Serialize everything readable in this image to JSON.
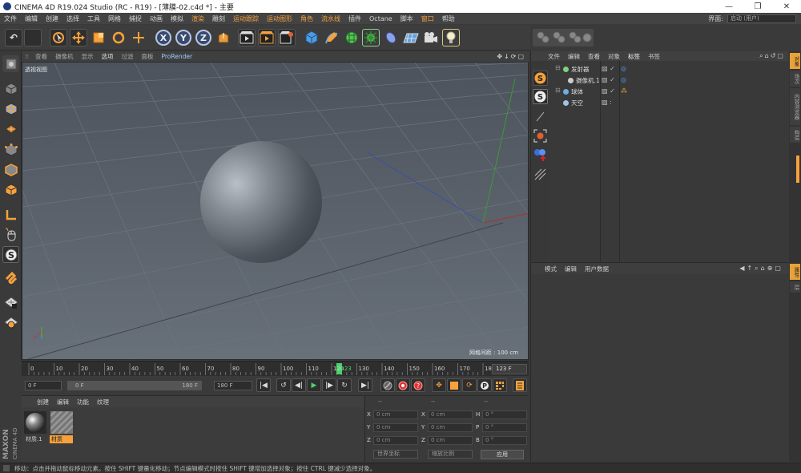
{
  "window": {
    "title": "CINEMA 4D R19.024 Studio (RC - R19) - [薄膜-02.c4d *] - 主要",
    "minimize": "—",
    "maximize": "❐",
    "close": "✕"
  },
  "menubar": {
    "items": [
      "文件",
      "编辑",
      "创建",
      "选择",
      "工具",
      "网格",
      "捕捉",
      "动画",
      "模拟",
      "渲染",
      "雕刻",
      "运动跟踪",
      "运动图形",
      "角色",
      "流水线",
      "插件",
      "Octane",
      "脚本",
      "窗口",
      "帮助"
    ],
    "layout_label": "界面:",
    "layout_value": "启动 (用户)"
  },
  "toolbar": {
    "x_label": "X",
    "y_label": "Y",
    "z_label": "Z"
  },
  "viewport": {
    "menu": [
      "查看",
      "摄像机",
      "显示",
      "选项",
      "过滤",
      "面板",
      "ProRender"
    ],
    "view_name": "透视视图",
    "grid_spacing": "网格间距 : 100 cm"
  },
  "timeline": {
    "ticks": [
      "0",
      "10",
      "20",
      "30",
      "40",
      "50",
      "60",
      "70",
      "80",
      "90",
      "100",
      "110",
      "120",
      "123",
      "130",
      "140",
      "150",
      "160",
      "170",
      "180"
    ],
    "current_frame": "123 F",
    "playhead_frame": 123
  },
  "playback": {
    "start_field": "0 F",
    "min_field": "0 F",
    "max_field": "180 F",
    "end_field": "180 F"
  },
  "material_manager": {
    "menu": [
      "创建",
      "编辑",
      "功能",
      "纹理"
    ],
    "materials": [
      {
        "label": "材质.1",
        "selected": false
      },
      {
        "label": "材质",
        "selected": true
      }
    ]
  },
  "coord_manager": {
    "header_cols": [
      "--",
      "--",
      "--"
    ],
    "rows": [
      {
        "l1": "X",
        "v1": "0 cm",
        "l2": "X",
        "v2": "0 cm",
        "l3": "H",
        "v3": "0 °"
      },
      {
        "l1": "Y",
        "v1": "0 cm",
        "l2": "Y",
        "v2": "0 cm",
        "l3": "P",
        "v3": "0 °"
      },
      {
        "l1": "Z",
        "v1": "0 cm",
        "l2": "Z",
        "v2": "0 cm",
        "l3": "B",
        "v3": "0 °"
      }
    ],
    "coord_mode": "世界坐标",
    "scale_mode": "缩放比例",
    "apply": "应用"
  },
  "object_manager": {
    "menu": [
      "文件",
      "编辑",
      "查看",
      "对象",
      "标签",
      "书签"
    ],
    "objects": [
      {
        "name": "发射器",
        "color": "#7fd27f"
      },
      {
        "name": "摄像机.1",
        "color": "#cccccc"
      },
      {
        "name": "球体",
        "color": "#6ab0e8"
      },
      {
        "name": "天空",
        "color": "#9fc3e8"
      }
    ]
  },
  "attribute_manager": {
    "menu": [
      "模式",
      "编辑",
      "用户数据"
    ]
  },
  "right_tabs": {
    "top": [
      "对象",
      "场次",
      "内容浏览器",
      "构造"
    ],
    "bottom": [
      "属性",
      "层"
    ]
  },
  "statusbar": {
    "text": "移动：点击并拖动鼠标移动元素。按住 SHIFT 键量化移动；节点编辑模式时按住 SHIFT 键增加选择对象；按住 CTRL 键减少选择对象。"
  },
  "brand": {
    "logo_text_1": "MAXON",
    "logo_text_2": "CINEMA 4D"
  },
  "colors": {
    "accent_orange": "#f6a13c",
    "viewport_bg": "#5b626b",
    "panel_bg": "#3a3a3a"
  }
}
